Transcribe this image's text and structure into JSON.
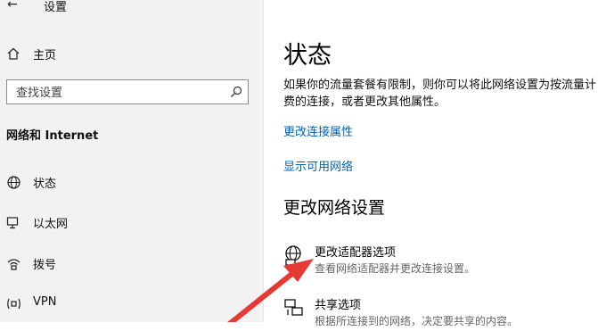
{
  "window": {
    "title": "设置"
  },
  "sidebar": {
    "home_label": "主页",
    "search_placeholder": "查找设置",
    "section_title": "网络和 Internet",
    "items": [
      {
        "label": "状态",
        "icon": "globe-icon"
      },
      {
        "label": "以太网",
        "icon": "monitor-icon"
      },
      {
        "label": "拨号",
        "icon": "dialup-icon"
      },
      {
        "label": "VPN",
        "icon": "vpn-icon"
      }
    ]
  },
  "main": {
    "title": "状态",
    "description": "如果你的流量套餐有限制，则你可以将此网络设置为按流量计费的连接，或者更改其他属性。",
    "links": [
      "更改连接属性",
      "显示可用网络"
    ],
    "section_title": "更改网络设置",
    "options": [
      {
        "title": "更改适配器选项",
        "subtitle": "查看网络适配器并更改连接设置。",
        "icon": "adapter-globe-icon"
      },
      {
        "title": "共享选项",
        "subtitle": "根据所连接到的网络，决定要共享的内容。",
        "icon": "sharing-icon"
      }
    ]
  },
  "annotation": {
    "arrow_color": "#e53935"
  }
}
